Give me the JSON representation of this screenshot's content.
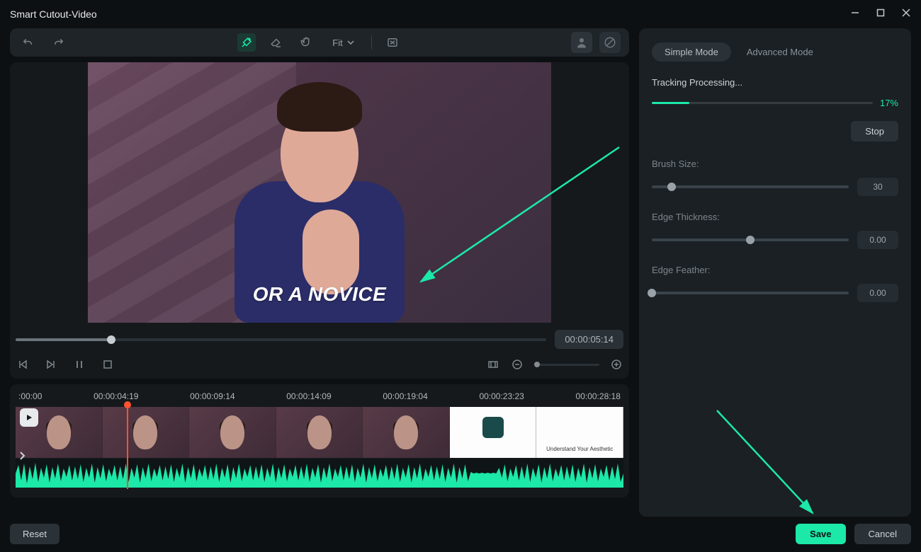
{
  "window": {
    "title": "Smart Cutout-Video"
  },
  "toolbar": {
    "fit_label": "Fit"
  },
  "preview": {
    "caption": "OR A NOVICE",
    "current_time": "00:00:05:14"
  },
  "timeline": {
    "ticks": [
      ":00:00",
      "00:00:04:19",
      "00:00:09:14",
      "00:00:14:09",
      "00:00:19:04",
      "00:00:23:23",
      "00:00:28:18"
    ]
  },
  "panel": {
    "modes": {
      "simple": "Simple Mode",
      "advanced": "Advanced Mode"
    },
    "processing_label": "Tracking Processing...",
    "progress_pct": "17%",
    "progress_value": 17,
    "stop_label": "Stop",
    "brush": {
      "label": "Brush Size:",
      "value": "30",
      "pct": 10
    },
    "edge_thickness": {
      "label": "Edge Thickness:",
      "value": "0.00",
      "pct": 50
    },
    "edge_feather": {
      "label": "Edge Feather:",
      "value": "0.00",
      "pct": 0
    }
  },
  "footer": {
    "reset": "Reset",
    "save": "Save",
    "cancel": "Cancel"
  }
}
